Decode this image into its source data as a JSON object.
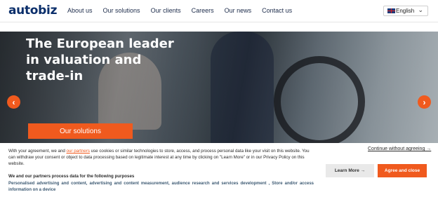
{
  "header": {
    "logo": "autobiz",
    "nav": [
      "About us",
      "Our solutions",
      "Our clients",
      "Careers",
      "Our news",
      "Contact us"
    ],
    "language": "English"
  },
  "hero": {
    "headline": "The European leader in valuation and trade-in",
    "cta_label": "Our solutions",
    "prev_glyph": "‹",
    "next_glyph": "›"
  },
  "consent": {
    "text_before_link": "With your agreement, we and ",
    "link_text": "our partners",
    "text_after_link": " use cookies or similar technologies to store, access, and process personal data like your visit on this website. You can withdraw your consent or object to data processing based on legitimate interest at any time by clicking on \"Learn More\" or in our Privacy Policy on this website.",
    "purposes_heading": "We and our partners process data for the following purposes",
    "purposes_text": "Personalised advertising and content, advertising and content measurement, audience research and services development , Store and/or access information on a device",
    "continue_label": "Continue without agreeing →",
    "learn_more_label": "Learn More →",
    "agree_label": "Agree and close"
  },
  "colors": {
    "brand_navy": "#0b2f6b",
    "accent_orange": "#f05a1e"
  }
}
